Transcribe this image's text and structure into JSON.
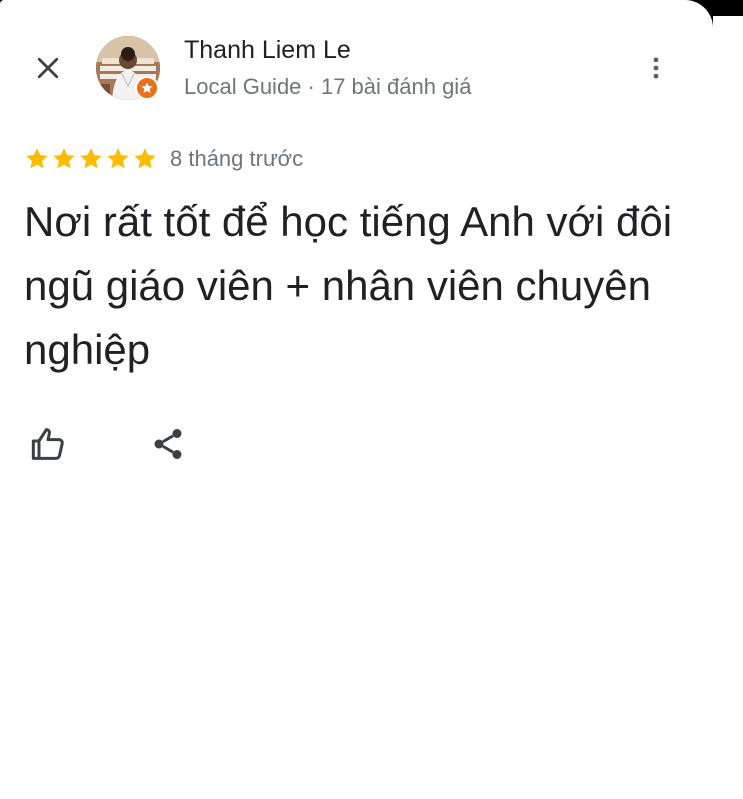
{
  "header": {
    "close_icon": "close-icon",
    "more_icon": "more-vert-icon"
  },
  "author": {
    "name": "Thanh Liem Le",
    "meta": "Local Guide · 17 bài đánh giá",
    "badge_icon": "local-guide-star-icon",
    "badge_color": "#e8711c"
  },
  "review": {
    "rating": 5,
    "max_rating": 5,
    "star_color": "#fbbc04",
    "time_ago": "8 tháng trước",
    "text": "Nơi rất tốt để học tiếng Anh với đôi ngũ giáo viên + nhân viên chuyên nghiệp"
  },
  "actions": {
    "like_icon": "thumb-up-icon",
    "share_icon": "share-icon"
  }
}
